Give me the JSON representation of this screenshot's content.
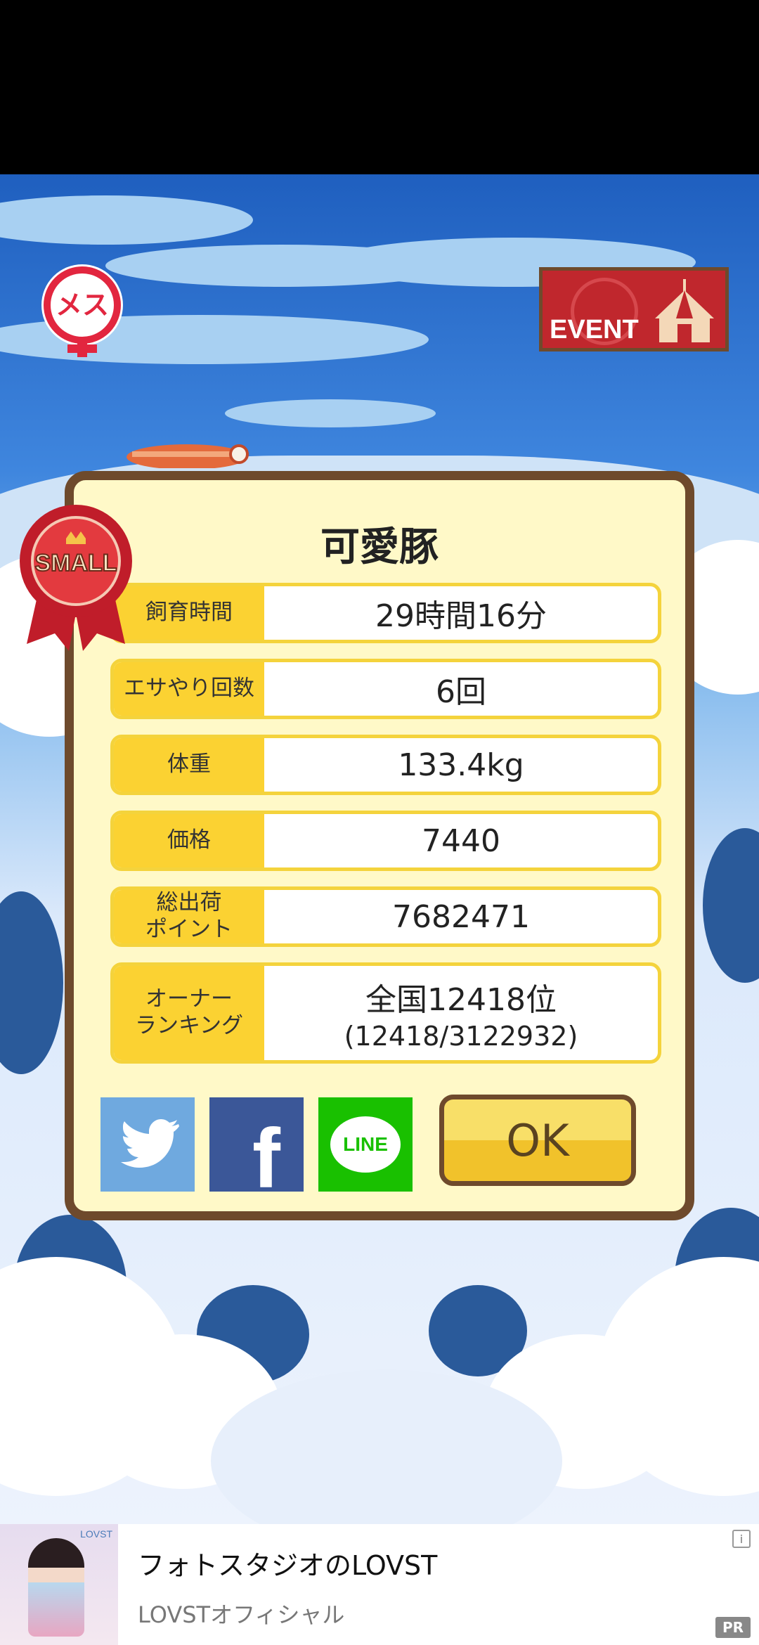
{
  "pig_name": "可愛豚",
  "gender_label": "メス",
  "event_label": "EVENT",
  "size_label": "SMALL",
  "stats": [
    {
      "label": "飼育時間",
      "value": "29時間16分"
    },
    {
      "label": "エサやり回数",
      "value": "6回"
    },
    {
      "label": "体重",
      "value": "133.4kg"
    },
    {
      "label": "価格",
      "value": "7440"
    },
    {
      "label": "総出荷\nポイント",
      "value": "7682471"
    },
    {
      "label": "オーナー\nランキング",
      "value": "全国12418位",
      "sub": "(12418/3122932)"
    }
  ],
  "share": {
    "line_label": "LINE",
    "facebook_label": "f"
  },
  "ok_label": "OK",
  "ad": {
    "title": "フォトスタジオのLOVST",
    "subtitle": "LOVSTオフィシャル",
    "pr": "PR",
    "info": "i",
    "thumb_brand": "LOVST"
  },
  "colors": {
    "label_bg": "#fbd232",
    "frame": "#6e4a2c",
    "panel": "#fff9c8"
  }
}
